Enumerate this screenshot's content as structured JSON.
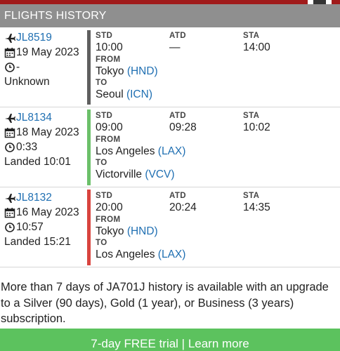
{
  "header": {
    "title": "FLIGHTS HISTORY"
  },
  "labels": {
    "std": "STD",
    "atd": "ATD",
    "sta": "STA",
    "from": "FROM",
    "to": "TO"
  },
  "flights": [
    {
      "flight_no": "JL8519",
      "date": "19 May 2023",
      "duration": "-",
      "status": "Unknown",
      "std": "10:00",
      "atd": "—",
      "sta": "14:00",
      "from_city": "Tokyo",
      "from_code": "(HND)",
      "to_city": "Seoul",
      "to_code": "(ICN)",
      "status_color": "#5f5f5f"
    },
    {
      "flight_no": "JL8134",
      "date": "18 May 2023",
      "duration": "0:33",
      "status": "Landed 10:01",
      "std": "09:00",
      "atd": "09:28",
      "sta": "10:02",
      "from_city": "Los Angeles",
      "from_code": "(LAX)",
      "to_city": "Victorville",
      "to_code": "(VCV)",
      "status_color": "#6cc06a"
    },
    {
      "flight_no": "JL8132",
      "date": "16 May 2023",
      "duration": "10:57",
      "status": "Landed 15:21",
      "std": "20:00",
      "atd": "20:24",
      "sta": "14:35",
      "from_city": "Tokyo",
      "from_code": "(HND)",
      "to_city": "Los Angeles",
      "to_code": "(LAX)",
      "status_color": "#d9443f"
    }
  ],
  "notice": "More than 7 days of JA701J history is available with an upgrade to a Silver (90 days), Gold (1 year), or Business (3 years) subscription.",
  "cta": {
    "label": "7-day FREE trial | Learn more"
  },
  "icons": {
    "plane": "plane-icon",
    "calendar": "calendar-icon",
    "clock": "clock-icon"
  },
  "colors": {
    "accent": "#a01b1b",
    "link": "#1f6fb2",
    "header_bg": "#8f8f8f",
    "cta_bg": "#5cc25e"
  }
}
